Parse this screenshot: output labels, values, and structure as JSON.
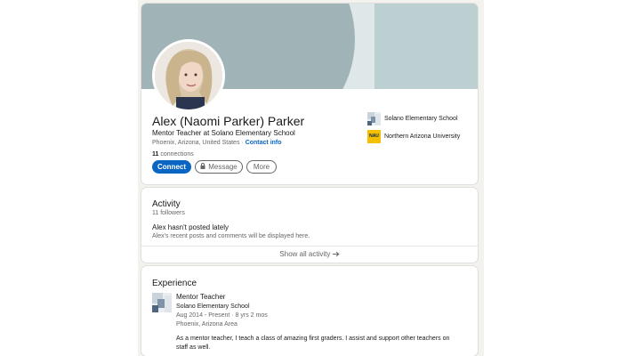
{
  "profile": {
    "name": "Alex (Naomi Parker) Parker",
    "headline": "Mentor Teacher at Solano Elementary School",
    "location": "Phoenix, Arizona, United States",
    "separator": " · ",
    "contact_info": "Contact info",
    "connections_count": "11",
    "connections_label": " connections",
    "connect_label": "Connect",
    "message_label": "Message",
    "more_label": "More",
    "orgs": [
      {
        "name": "Solano Elementary School",
        "icon": "school-logo"
      },
      {
        "name": "Northern Arizona University",
        "icon": "nau-logo",
        "logo_text": "NAU"
      }
    ]
  },
  "activity": {
    "title": "Activity",
    "followers": "11 followers",
    "empty_title": "Alex hasn't posted lately",
    "empty_subtitle": "Alex's recent posts and comments will be displayed here.",
    "show_all": "Show all activity"
  },
  "experience": {
    "title": "Experience",
    "items": [
      {
        "role": "Mentor Teacher",
        "company": "Solano Elementary School",
        "dates": "Aug 2014 - Present · 8 yrs 2 mos",
        "location": "Phoenix, Arizona Area",
        "description": "As a mentor teacher, I teach a class of amazing first graders. I assist and support other teachers on staff as well."
      }
    ]
  },
  "colors": {
    "primary": "#0a66c2",
    "banner": "#a0b4b8",
    "nau_gold": "#f5c000"
  }
}
